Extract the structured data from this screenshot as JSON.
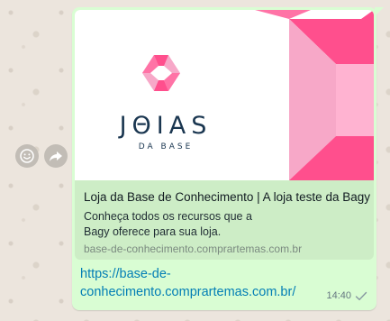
{
  "chat": {
    "actions": {
      "emoji_icon": "smiley-icon",
      "forward_icon": "forward-arrow-icon"
    },
    "message": {
      "link_preview": {
        "image": {
          "logo_wordmark": "JΘIAS",
          "logo_subtitle": "DA BASE",
          "colors": {
            "pink_light": "#f7a8c8",
            "pink_dark": "#ff4f8d",
            "navy": "#1a3650"
          }
        },
        "title": "Loja da Base de Conhecimento | A loja teste da Bagy",
        "description": "Conheça todos os recursos que a Bagy oferece para sua loja.",
        "domain": "base-de-conhecimento.comprartemas.com.br"
      },
      "link_text": "https://base-de-conhecimento.comprartemas.com.br/",
      "time": "14:40",
      "status_icon": "single-check-icon"
    },
    "colors": {
      "bubble": "#d9fdd3",
      "preview_card": "#cdedc6",
      "link": "#027eb5",
      "background": "#ece5dd"
    }
  }
}
